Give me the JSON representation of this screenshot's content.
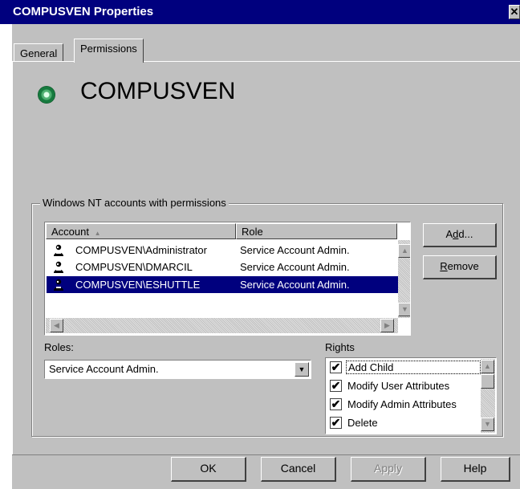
{
  "window": {
    "title": "COMPUSVEN Properties",
    "close_glyph": "✕"
  },
  "tabs": [
    {
      "label": "General"
    },
    {
      "label": "Permissions"
    }
  ],
  "header": {
    "object_name": "COMPUSVEN",
    "icon": "directory-object-icon"
  },
  "accounts_group": {
    "label": "Windows NT accounts with permissions",
    "columns": [
      {
        "label": "Account",
        "sort_glyph": "▲"
      },
      {
        "label": "Role"
      }
    ],
    "rows": [
      {
        "account": "COMPUSVEN\\Administrator",
        "role": "Service Account Admin.",
        "icon": "user-icon",
        "selected": false
      },
      {
        "account": "COMPUSVEN\\DMARCIL",
        "role": "Service Account Admin.",
        "icon": "user-icon",
        "selected": false
      },
      {
        "account": "COMPUSVEN\\ESHUTTLE",
        "role": "Service Account Admin.",
        "icon": "user-icon",
        "selected": true
      }
    ],
    "add_button": {
      "label": "Add...",
      "mnemonic": "d"
    },
    "remove_button": {
      "label": "Remove",
      "mnemonic": "R"
    }
  },
  "roles": {
    "label": "Roles:",
    "selected_value": "Service Account Admin."
  },
  "rights": {
    "label": "Rights",
    "items": [
      {
        "label": "Add Child",
        "checked": true
      },
      {
        "label": "Modify User Attributes",
        "checked": true
      },
      {
        "label": "Modify Admin Attributes",
        "checked": true
      },
      {
        "label": "Delete",
        "checked": true
      }
    ]
  },
  "footer": {
    "ok": "OK",
    "cancel": "Cancel",
    "apply": "Apply",
    "help": "Help"
  },
  "colors": {
    "titlebar": "#00007e",
    "face": "#c0c0c0",
    "selection": "#00007e"
  }
}
